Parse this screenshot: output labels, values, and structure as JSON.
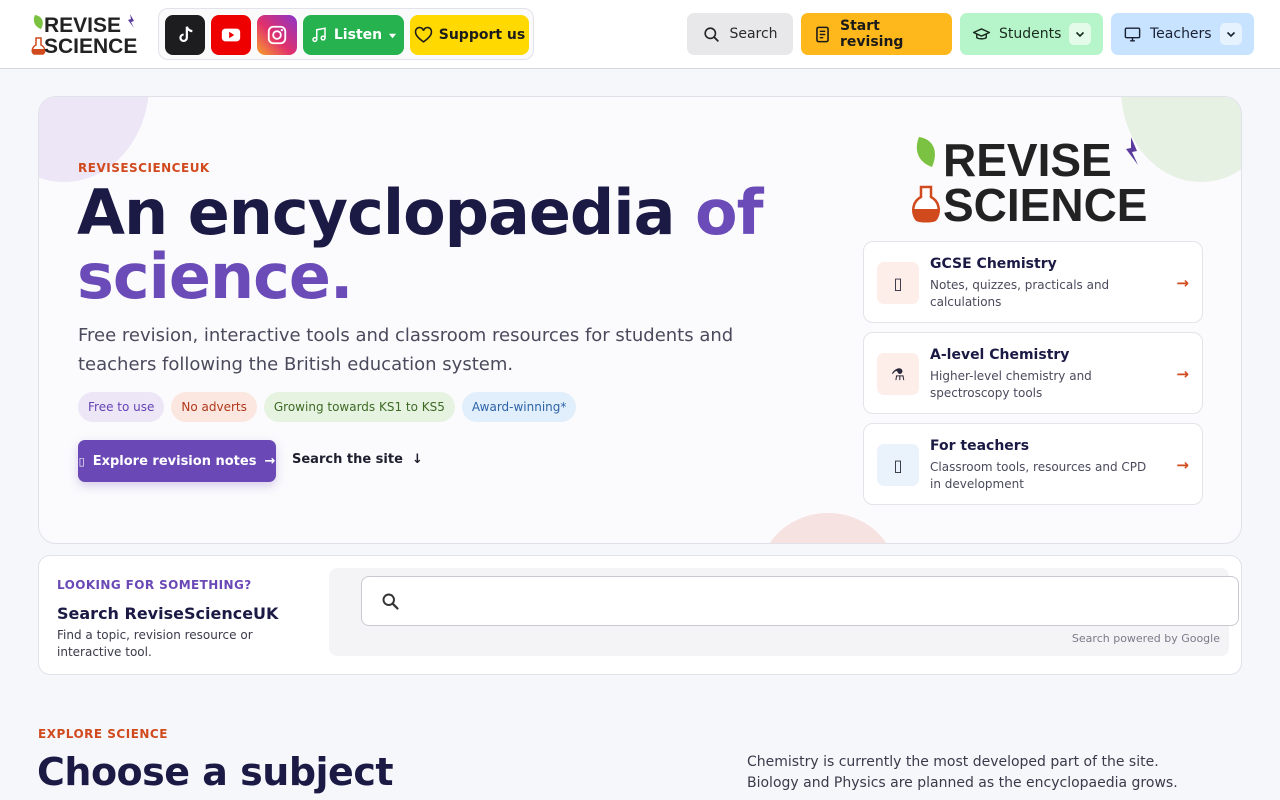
{
  "header": {
    "logo": {
      "line1": "REVISE",
      "line2": "SCIENCE"
    },
    "social": {
      "tiktok_icon": "tiktok-icon",
      "youtube_icon": "youtube-icon",
      "instagram_icon": "instagram-icon",
      "listen_label": "Listen",
      "support_label": "Support us"
    },
    "search_label": "Search",
    "start_label": "Start revising",
    "students_label": "Students",
    "teachers_label": "Teachers"
  },
  "hero": {
    "eyebrow": "REVISESCIENCEUK",
    "title_part1": "An encyclopaedia ",
    "title_accent1": "of",
    "title_accent2": "science.",
    "lead": "Free revision, interactive tools and classroom resources for students and teachers following the British education system.",
    "tags": [
      "Free to use",
      "No adverts",
      "Growing towards KS1 to KS5",
      "Award-winning*"
    ],
    "cta_label": "Explore revision notes",
    "search_link": "Search the site",
    "cards": [
      {
        "title": "GCSE Chemistry",
        "desc": "Notes, quizzes, practicals and calculations",
        "arrow": "→"
      },
      {
        "title": "A-level Chemistry",
        "desc": "Higher-level chemistry and spectroscopy tools",
        "arrow": "→"
      },
      {
        "title": "For teachers",
        "desc": "Classroom tools, resources and CPD in development",
        "arrow": "→"
      }
    ]
  },
  "search_section": {
    "eyebrow": "LOOKING FOR SOMETHING?",
    "title": "Search ReviseScienceUK",
    "desc": "Find a topic, revision resource or interactive tool.",
    "input_value": "",
    "powered": "Search powered by Google"
  },
  "explore": {
    "eyebrow": "EXPLORE SCIENCE",
    "title": "Choose a subject",
    "text": "Chemistry is currently the most developed part of the site. Biology and Physics are planned as the encyclopaedia grows."
  },
  "colors": {
    "accent_purple": "#6a48b6",
    "accent_orange": "#d14a1e",
    "listen_green": "#26b34f",
    "support_yellow": "#ffd900",
    "start_amber": "#ffb81c"
  }
}
